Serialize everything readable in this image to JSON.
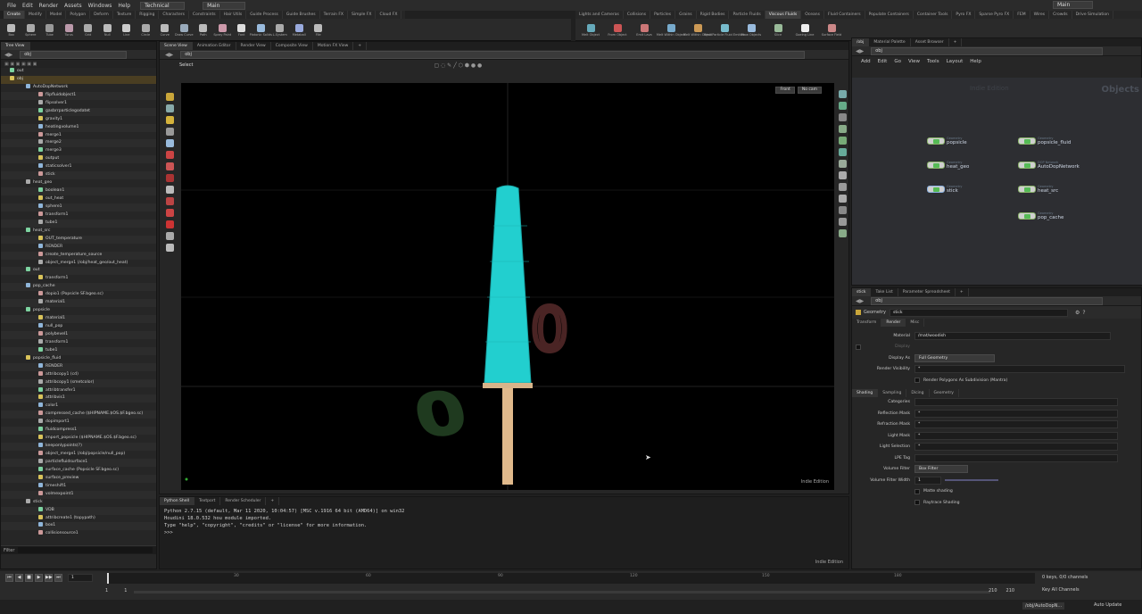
{
  "menu": [
    "File",
    "Edit",
    "Render",
    "Assets",
    "Windows",
    "Help"
  ],
  "desktop": "Technical",
  "context": "Main",
  "shelf_tabs_left": [
    "Create",
    "Modify",
    "Model",
    "Polygon",
    "Deform",
    "Texture",
    "Rigging",
    "Characters",
    "Constraints",
    "Hair Utils",
    "Guide Process",
    "Guide Brushes",
    "Terrain FX",
    "Simple FX",
    "Cloud FX",
    "Volume",
    "TD Tools"
  ],
  "shelf_tabs_right": [
    "Lights and Cameras",
    "Collisions",
    "Particles",
    "Grains",
    "Rigid Bodies",
    "Particle Fluids",
    "Viscous Fluids",
    "Oceans",
    "Fluid Containers",
    "Populate Containers",
    "Container Tools",
    "Pyro FX",
    "Sparse Pyro FX",
    "FEM",
    "Wires",
    "Crowds",
    "Drive Simulation"
  ],
  "tools_left": [
    "Box",
    "Sphere",
    "Tube",
    "Torus",
    "Grid",
    "Null",
    "Line",
    "Circle",
    "Curve",
    "Draw Curve",
    "Path",
    "Spray Paint",
    "Font",
    "Platonic Solids",
    "L-System",
    "Metaball",
    "File"
  ],
  "tools_right": [
    "Melt Object",
    "From Object",
    "Emit Lava",
    "Melt Within Object",
    "Melt Within Object",
    "Emit Particle Fluid Emitter",
    "Flow Objects",
    "Slice",
    "Goeing Line",
    "Surface Field"
  ],
  "tree": {
    "tab": "Tree View",
    "path": "obj",
    "items": [
      "out",
      "obj",
      "AutoDopNetwork",
      "flipfluidobject1",
      "flipsolver1",
      "gasbrrparticlegodatet",
      "gravity1",
      "heatingvolume1",
      "merge1",
      "merge2",
      "merge3",
      "output",
      "staticsolver1",
      "stick",
      "heat_geo",
      "boolean1",
      "out_heat",
      "sphere1",
      "transform1",
      "tube1",
      "heat_src",
      "OUT_temperature",
      "RENDER",
      "create_temperature_source",
      "object_merge1 (/obj/heat_geo/out_heat)",
      "out",
      "transform1",
      "pop_cache",
      "dopio1 (Popsicle SF.bgeo.sc)",
      "material1",
      "popsicle",
      "material1",
      "null_pop",
      "polybevel1",
      "transform1",
      "tube1",
      "popsicle_fluid",
      "RENDER",
      "attribcopy1 (cd)",
      "attribcopy1 (smetcolor)",
      "attribtransfer1",
      "attribvis1",
      "color1",
      "compressed_cache ($HIPNAME.$OS.$F.bgeo.sc)",
      "dopimport1",
      "fluidcompress1",
      "import_popsicle ($HIPNAME.$OS.$F.bgeo.sc)",
      "keeponlypoints(?)",
      "object_merge1 (/obj/popsicle/null_pop)",
      "particlefluidsurface1",
      "surface_cache (Popsicle SF.bgeo.sc)",
      "surface_preview",
      "timeshift1",
      "volmexpoint1",
      "stick",
      "VDB",
      "attribcreate1 (topypath)",
      "box1",
      "collisionsource1"
    ],
    "filter_label": "Filter"
  },
  "viewport": {
    "tabs": [
      "Scene View",
      "Animation Editor",
      "Render View",
      "Composite View",
      "Motion FX View"
    ],
    "path": "obj",
    "select_label": "Select",
    "camera": "Front",
    "cam_opt": "No cam",
    "edition": "Indie Edition",
    "frame_digit_a": "0",
    "frame_digit_b": "0"
  },
  "console": {
    "tabs": [
      "Python Shell",
      "Textport",
      "Render Scheduler"
    ],
    "lines": [
      "Python 2.7.15 (default, Mar 11 2020, 10:04:57) [MSC v.1916 64 bit (AMD64)] on win32",
      "Houdini 18.0.532 hou module imported.",
      "Type \"help\", \"copyright\", \"credits\" or \"license\" for more information.",
      ">>>"
    ],
    "edition": "Indie Edition"
  },
  "network": {
    "tabs": [
      "/obj",
      "Material Palette",
      "Asset Browser"
    ],
    "path": "obj",
    "menu": [
      "Add",
      "Edit",
      "Go",
      "View",
      "Tools",
      "Layout",
      "Help"
    ],
    "watermark_left": "Indie Edition",
    "watermark_right": "Objects",
    "nodes": [
      {
        "name": "popsicle",
        "type": "Geometry"
      },
      {
        "name": "popsicle_fluid",
        "type": "Geometry"
      },
      {
        "name": "heat_geo",
        "type": "Geometry"
      },
      {
        "name": "AutoDopNetwork",
        "type": "DOP Network"
      },
      {
        "name": "stick",
        "type": "Geometry"
      },
      {
        "name": "heat_src",
        "type": "Geometry"
      },
      {
        "name": "pop_cache",
        "type": "Geometry"
      }
    ]
  },
  "params": {
    "tabs": [
      "stick",
      "Take List",
      "Parameter Spreadsheet"
    ],
    "path": "obj",
    "node_type": "Geometry",
    "node_name": "stick",
    "top_tabs": [
      "Transform",
      "Render",
      "Misc"
    ],
    "material_label": "Material",
    "material_value": "/mat/woodish",
    "display_label": "Display",
    "display_as_label": "Display As",
    "display_as_value": "Full Geometry",
    "render_vis_label": "Render Visibility",
    "render_vis_value": "*",
    "render_polys_label": "Render Polygons As Subdivision (Mantra)",
    "sub_tabs": [
      "Shading",
      "Sampling",
      "Dicing",
      "Geometry"
    ],
    "rows": [
      {
        "label": "Categories",
        "value": ""
      },
      {
        "label": "Reflection Mask",
        "value": "*"
      },
      {
        "label": "Refraction Mask",
        "value": "*"
      },
      {
        "label": "Light Mask",
        "value": "*"
      },
      {
        "label": "Light Selection",
        "value": "*"
      },
      {
        "label": "LPE Tag",
        "value": ""
      }
    ],
    "volume_filter_label": "Volume Filter",
    "volume_filter_value": "Box Filter",
    "volume_filter_width_label": "Volume Filter Width",
    "volume_filter_width_value": "1",
    "matte_label": "Matte shading",
    "raytrace_label": "Raytrace Shading"
  },
  "timeline": {
    "frame": "1",
    "ticks": [
      "30",
      "60",
      "90",
      "120",
      "150",
      "180"
    ],
    "start_a": "1",
    "start_b": "1",
    "end_a": "210",
    "end_b": "210",
    "keys_info": "0 keys, 0/0 channels",
    "key_all": "Key All Channels",
    "status_path": "/obj/AutoDopN...",
    "auto_update": "Auto Update"
  }
}
